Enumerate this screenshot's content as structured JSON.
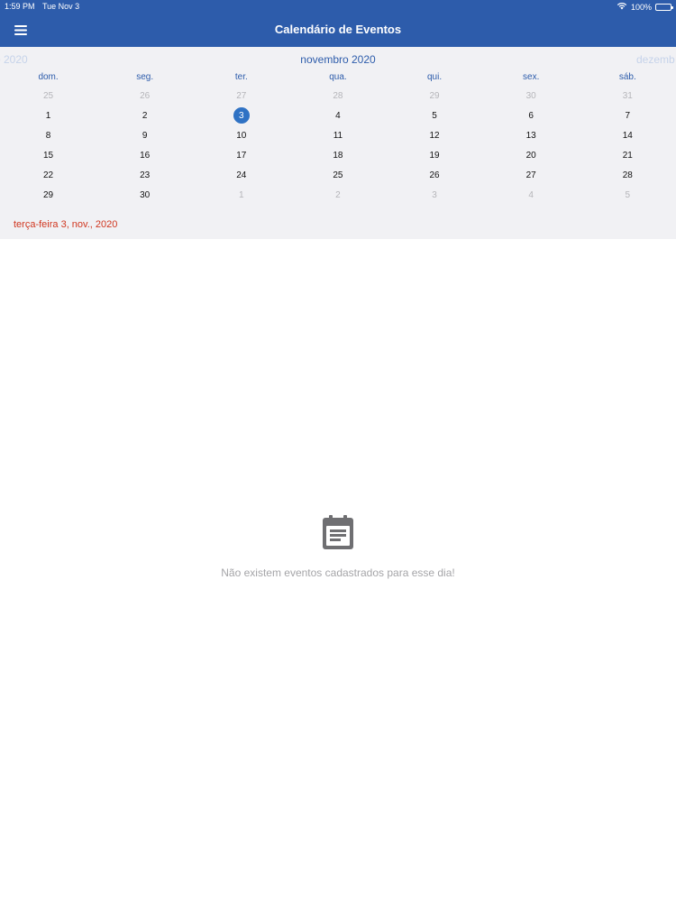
{
  "status": {
    "time": "1:59 PM",
    "date": "Tue Nov 3",
    "battery": "100%",
    "battery_level": 1.0
  },
  "nav": {
    "title": "Calendário de Eventos",
    "menu_icon": "hamburger-menu-icon"
  },
  "calendar": {
    "prev_month": "o 2020",
    "current_month": "novembro 2020",
    "next_month": "dezemb",
    "weekdays": [
      "dom.",
      "seg.",
      "ter.",
      "qua.",
      "qui.",
      "sex.",
      "sáb."
    ],
    "weeks": [
      [
        {
          "d": "25",
          "other": true
        },
        {
          "d": "26",
          "other": true
        },
        {
          "d": "27",
          "other": true
        },
        {
          "d": "28",
          "other": true
        },
        {
          "d": "29",
          "other": true
        },
        {
          "d": "30",
          "other": true
        },
        {
          "d": "31",
          "other": true
        }
      ],
      [
        {
          "d": "1"
        },
        {
          "d": "2"
        },
        {
          "d": "3",
          "selected": true
        },
        {
          "d": "4"
        },
        {
          "d": "5"
        },
        {
          "d": "6"
        },
        {
          "d": "7"
        }
      ],
      [
        {
          "d": "8"
        },
        {
          "d": "9"
        },
        {
          "d": "10"
        },
        {
          "d": "11"
        },
        {
          "d": "12"
        },
        {
          "d": "13"
        },
        {
          "d": "14"
        }
      ],
      [
        {
          "d": "15"
        },
        {
          "d": "16"
        },
        {
          "d": "17"
        },
        {
          "d": "18"
        },
        {
          "d": "19"
        },
        {
          "d": "20"
        },
        {
          "d": "21"
        }
      ],
      [
        {
          "d": "22"
        },
        {
          "d": "23"
        },
        {
          "d": "24"
        },
        {
          "d": "25"
        },
        {
          "d": "26"
        },
        {
          "d": "27"
        },
        {
          "d": "28"
        }
      ],
      [
        {
          "d": "29"
        },
        {
          "d": "30"
        },
        {
          "d": "1",
          "other": true
        },
        {
          "d": "2",
          "other": true
        },
        {
          "d": "3",
          "other": true
        },
        {
          "d": "4",
          "other": true
        },
        {
          "d": "5",
          "other": true
        }
      ]
    ],
    "selected_date_label": "terça-feira 3, nov., 2020"
  },
  "empty_state": {
    "icon": "calendar-event-icon",
    "message": "Não existem eventos cadastrados para esse dia!"
  },
  "colors": {
    "primary": "#2d5cab",
    "selected_day": "#2f72c4",
    "date_label": "#d0361f",
    "calendar_bg": "#f1f1f4"
  }
}
